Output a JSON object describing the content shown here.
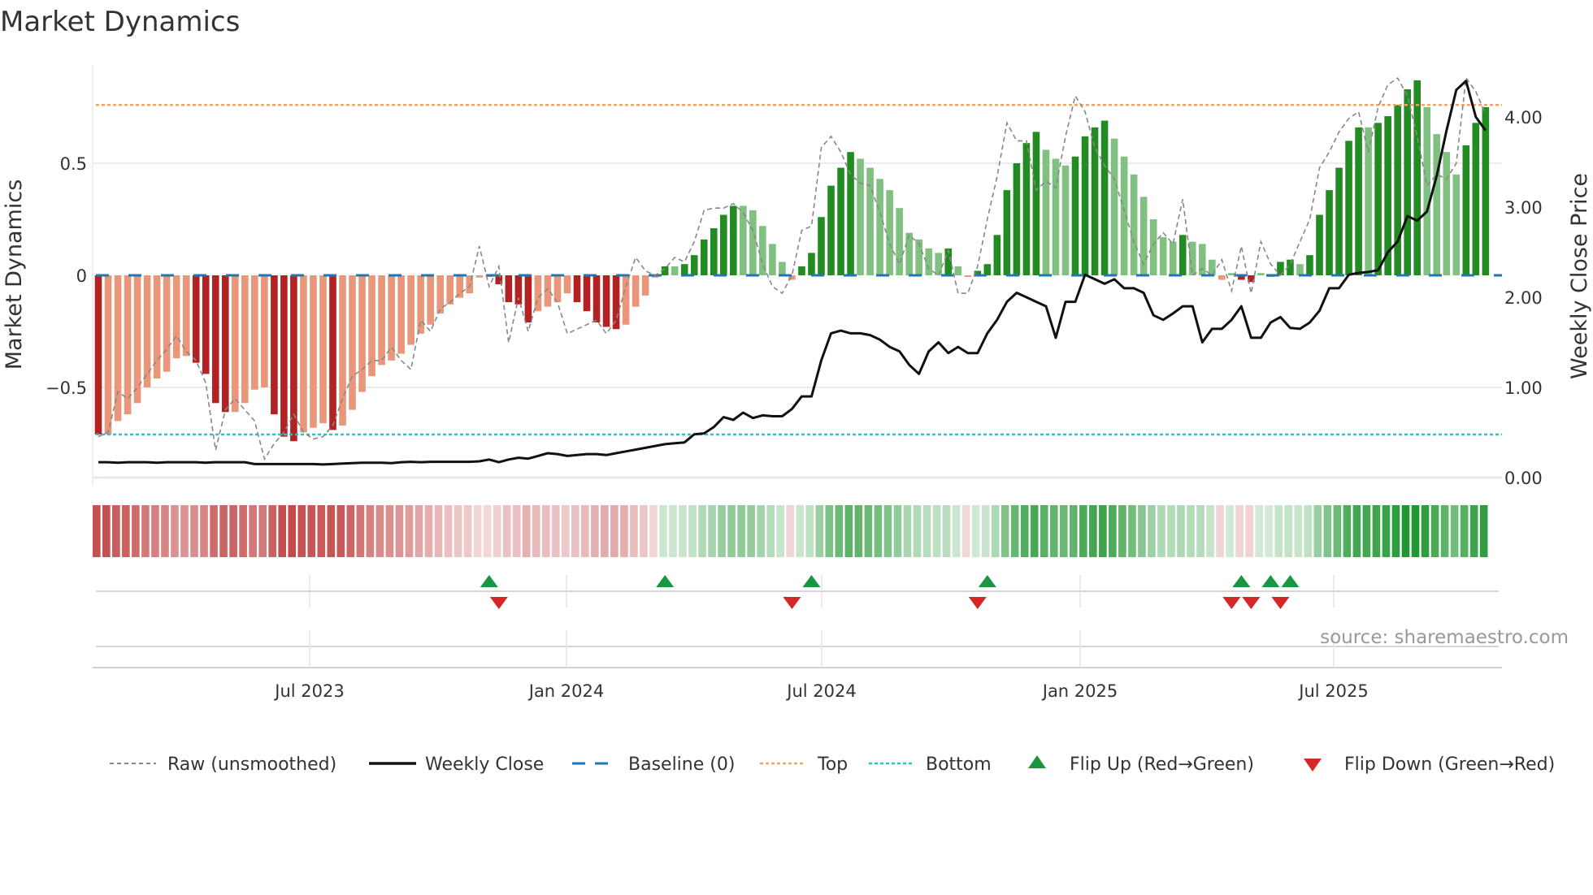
{
  "chart_data": {
    "type": "bar",
    "title": "Market Dynamics",
    "ylabel": "Market Dynamics",
    "y2label": "Weekly Close Price",
    "ylim": [
      -0.9,
      0.95
    ],
    "y2lim": [
      0,
      4.7
    ],
    "yticks": [
      {
        "v": 0.5,
        "label": "0.5"
      },
      {
        "v": 0,
        "label": "0"
      },
      {
        "v": -0.5,
        "label": "−0.5"
      }
    ],
    "y2ticks": [
      {
        "v": 4,
        "label": "4.00"
      },
      {
        "v": 3,
        "label": "3.00"
      },
      {
        "v": 2,
        "label": "2.00"
      },
      {
        "v": 1,
        "label": "1.00"
      },
      {
        "v": 0,
        "label": "0.00"
      }
    ],
    "xticks": [
      "Jul 2023",
      "Jan 2024",
      "Jul 2024",
      "Jan 2025",
      "Jul 2025"
    ],
    "frequency": "weekly",
    "top_level": 0.76,
    "bottom_level": -0.71,
    "baseline": 0,
    "smoothed": [
      -0.71,
      -0.71,
      -0.65,
      -0.62,
      -0.57,
      -0.5,
      -0.46,
      -0.43,
      -0.37,
      -0.36,
      -0.39,
      -0.44,
      -0.57,
      -0.61,
      -0.61,
      -0.57,
      -0.51,
      -0.5,
      -0.62,
      -0.72,
      -0.74,
      -0.7,
      -0.68,
      -0.66,
      -0.69,
      -0.67,
      -0.6,
      -0.52,
      -0.45,
      -0.4,
      -0.38,
      -0.35,
      -0.31,
      -0.26,
      -0.22,
      -0.17,
      -0.13,
      -0.1,
      -0.08,
      -0.01,
      -0.005,
      -0.04,
      -0.12,
      -0.13,
      -0.21,
      -0.16,
      -0.14,
      -0.12,
      -0.08,
      -0.12,
      -0.16,
      -0.21,
      -0.23,
      -0.24,
      -0.22,
      -0.14,
      -0.09,
      -0.01,
      0.04,
      0.04,
      0.05,
      0.09,
      0.16,
      0.21,
      0.27,
      0.31,
      0.31,
      0.29,
      0.22,
      0.14,
      0.06,
      -0.02,
      0.04,
      0.1,
      0.26,
      0.4,
      0.48,
      0.55,
      0.52,
      0.48,
      0.43,
      0.38,
      0.3,
      0.19,
      0.16,
      0.12,
      0.1,
      0.12,
      0.04,
      -0.005,
      0.02,
      0.05,
      0.18,
      0.38,
      0.5,
      0.59,
      0.64,
      0.56,
      0.52,
      0.49,
      0.53,
      0.62,
      0.66,
      0.69,
      0.61,
      0.53,
      0.45,
      0.35,
      0.25,
      0.17,
      0.15,
      0.18,
      0.15,
      0.14,
      0.07,
      -0.02,
      0.01,
      -0.02,
      -0.03,
      0.01,
      0.0,
      0.06,
      0.07,
      0.05,
      0.09,
      0.27,
      0.38,
      0.48,
      0.6,
      0.66,
      0.66,
      0.68,
      0.71,
      0.76,
      0.83,
      0.87,
      0.75,
      0.63,
      0.55,
      0.45,
      0.58,
      0.68,
      0.75
    ],
    "raw": [
      -0.72,
      -0.7,
      -0.52,
      -0.55,
      -0.5,
      -0.44,
      -0.38,
      -0.33,
      -0.27,
      -0.34,
      -0.38,
      -0.48,
      -0.78,
      -0.6,
      -0.55,
      -0.6,
      -0.65,
      -0.82,
      -0.75,
      -0.7,
      -0.62,
      -0.7,
      -0.73,
      -0.72,
      -0.67,
      -0.55,
      -0.45,
      -0.42,
      -0.38,
      -0.38,
      -0.32,
      -0.38,
      -0.42,
      -0.2,
      -0.25,
      -0.15,
      -0.12,
      -0.08,
      -0.05,
      0.13,
      -0.05,
      0.04,
      -0.3,
      -0.1,
      -0.25,
      -0.1,
      -0.06,
      -0.12,
      -0.26,
      -0.24,
      -0.22,
      -0.2,
      -0.26,
      -0.2,
      -0.05,
      0.08,
      0.02,
      0.0,
      0.03,
      0.08,
      0.06,
      0.15,
      0.29,
      0.3,
      0.3,
      0.32,
      0.28,
      0.2,
      0.05,
      -0.05,
      -0.08,
      0.0,
      0.2,
      0.22,
      0.57,
      0.62,
      0.55,
      0.45,
      0.41,
      0.4,
      0.28,
      0.14,
      0.05,
      0.18,
      0.14,
      0.03,
      0.0,
      0.11,
      -0.08,
      -0.08,
      0.04,
      0.25,
      0.44,
      0.68,
      0.6,
      0.6,
      0.38,
      0.42,
      0.39,
      0.62,
      0.8,
      0.73,
      0.57,
      0.49,
      0.43,
      0.29,
      0.15,
      0.05,
      0.14,
      0.19,
      0.14,
      0.34,
      0.0,
      0.03,
      0.0,
      0.07,
      -0.07,
      0.13,
      -0.08,
      0.15,
      0.05,
      0.0,
      0.05,
      0.15,
      0.25,
      0.48,
      0.55,
      0.64,
      0.7,
      0.73,
      0.55,
      0.75,
      0.85,
      0.88,
      0.8,
      0.62,
      0.4,
      0.45,
      0.43,
      0.5,
      0.88,
      0.82,
      0.72
    ],
    "weekly_close": [
      0.17,
      0.17,
      0.165,
      0.17,
      0.17,
      0.17,
      0.165,
      0.17,
      0.17,
      0.17,
      0.17,
      0.165,
      0.17,
      0.17,
      0.17,
      0.17,
      0.15,
      0.15,
      0.15,
      0.15,
      0.15,
      0.15,
      0.15,
      0.145,
      0.15,
      0.155,
      0.16,
      0.165,
      0.165,
      0.165,
      0.16,
      0.17,
      0.175,
      0.17,
      0.175,
      0.175,
      0.175,
      0.175,
      0.175,
      0.18,
      0.2,
      0.17,
      0.2,
      0.22,
      0.21,
      0.24,
      0.27,
      0.26,
      0.24,
      0.25,
      0.26,
      0.26,
      0.25,
      0.27,
      0.29,
      0.31,
      0.33,
      0.35,
      0.37,
      0.38,
      0.39,
      0.48,
      0.49,
      0.56,
      0.67,
      0.64,
      0.72,
      0.66,
      0.69,
      0.68,
      0.68,
      0.76,
      0.9,
      0.9,
      1.3,
      1.6,
      1.63,
      1.6,
      1.6,
      1.58,
      1.53,
      1.45,
      1.4,
      1.25,
      1.15,
      1.4,
      1.5,
      1.38,
      1.45,
      1.38,
      1.38,
      1.6,
      1.75,
      1.95,
      2.05,
      2.0,
      1.95,
      1.9,
      1.55,
      1.95,
      1.95,
      2.25,
      2.2,
      2.15,
      2.2,
      2.1,
      2.1,
      2.05,
      1.8,
      1.75,
      1.82,
      1.9,
      1.9,
      1.5,
      1.65,
      1.65,
      1.75,
      1.9,
      1.55,
      1.55,
      1.72,
      1.78,
      1.66,
      1.65,
      1.72,
      1.85,
      2.1,
      2.1,
      2.25,
      2.27,
      2.28,
      2.3,
      2.5,
      2.62,
      2.9,
      2.85,
      2.95,
      3.35,
      3.85,
      4.3,
      4.4,
      4.0,
      3.85
    ],
    "flip_up_weeks": [
      41,
      59,
      74,
      92,
      118,
      121,
      123
    ],
    "flip_down_weeks": [
      42,
      72,
      91,
      117,
      119,
      122
    ],
    "legend": {
      "placement": "bottom",
      "raw": "Raw (unsmoothed)",
      "close": "Weekly Close",
      "baseline": "Baseline (0)",
      "top": "Top",
      "bottom": "Bottom",
      "flip_up": "Flip Up (Red→Green)",
      "flip_down": "Flip Down (Green→Red)"
    },
    "source": "source: sharemaestro.com",
    "colors": {
      "pos_strong": "#228b22",
      "pos_weak": "#80c080",
      "neg_strong": "#b22222",
      "neg_weak": "#e9967a",
      "baseline": "#1f77b4",
      "top": "#f4a460",
      "bottom": "#22c5d5",
      "flip_up": "#1a9641",
      "flip_down": "#d62728",
      "close": "#111111",
      "raw": "#888888"
    }
  }
}
